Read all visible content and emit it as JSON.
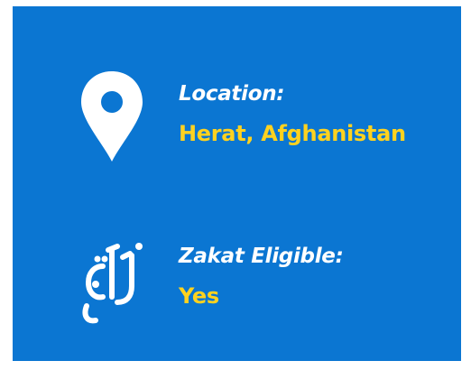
{
  "colors": {
    "card_background": "#0b76d2",
    "label_text": "#ffffff",
    "value_text": "#ffd21f"
  },
  "location": {
    "icon": "map-pin-icon",
    "label": "Location:",
    "value": "Herat, Afghanistan"
  },
  "zakat": {
    "icon": "zakat-calligraphy-icon",
    "icon_text": "زكاة",
    "label": "Zakat Eligible:",
    "value": "Yes"
  }
}
